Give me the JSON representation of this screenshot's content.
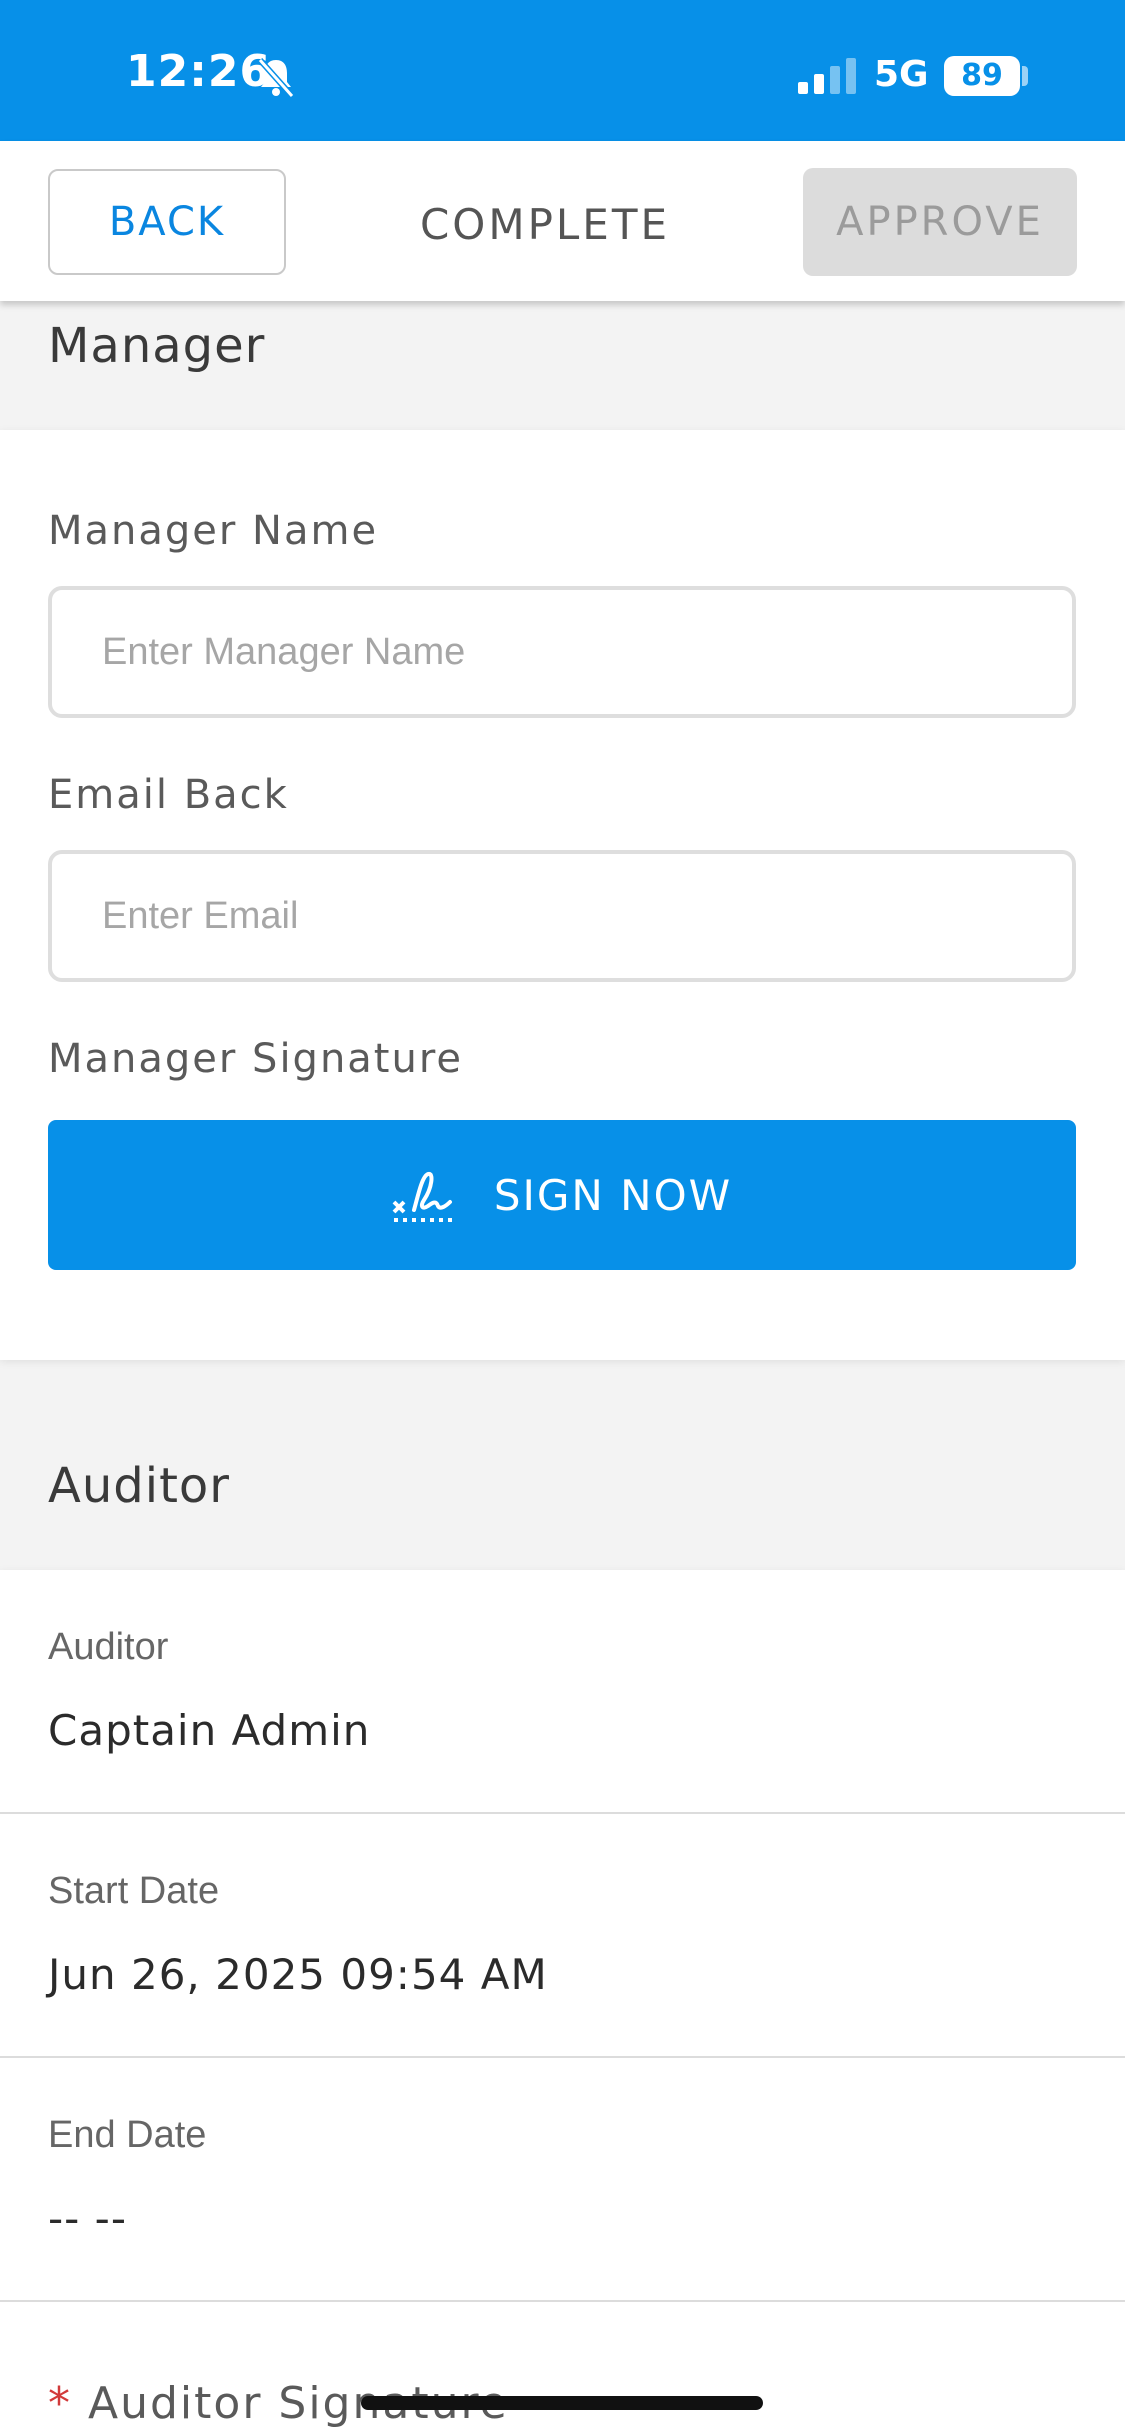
{
  "status_bar": {
    "time": "12:26",
    "mute_icon": "bell-slash-icon",
    "network": "5G",
    "battery": "89"
  },
  "toolbar": {
    "back_label": "BACK",
    "complete_label": "COMPLETE",
    "approve_label": "APPROVE"
  },
  "manager": {
    "section_title": "Manager",
    "name_label": "Manager Name",
    "name_placeholder": "Enter Manager Name",
    "name_value": "",
    "email_label": "Email Back",
    "email_placeholder": "Enter Email",
    "email_value": "",
    "signature_label": "Manager Signature",
    "sign_button_label": "SIGN NOW",
    "sign_icon": "signature-icon"
  },
  "auditor": {
    "section_title": "Auditor",
    "auditor_label": "Auditor",
    "auditor_value": "Captain Admin",
    "start_label": "Start Date",
    "start_value": "Jun 26, 2025 09:54 AM",
    "end_label": "End Date",
    "end_value": "-- --",
    "signature_required_mark": "*",
    "signature_label": "Auditor Signature"
  },
  "colors": {
    "accent": "#0790e8",
    "disabled_bg": "#dcdcdc",
    "required": "#d23a3a"
  }
}
